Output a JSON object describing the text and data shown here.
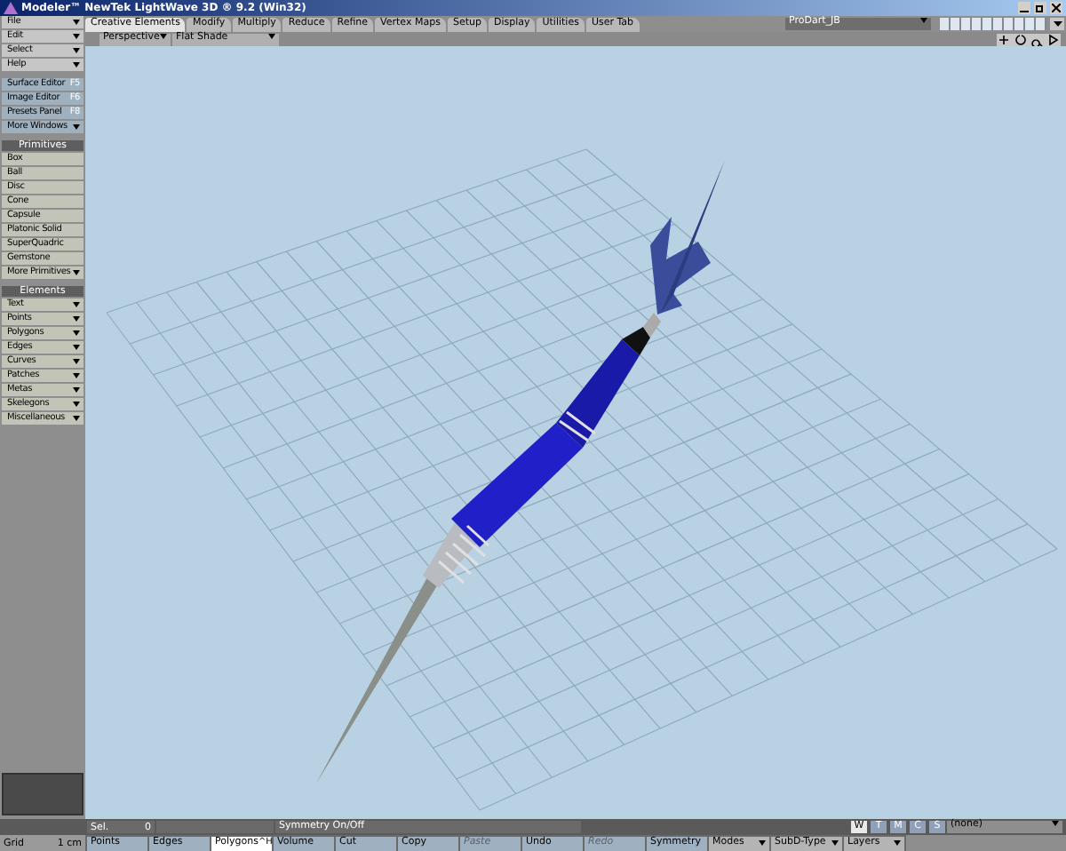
{
  "window": {
    "title": "Modeler™ NewTek LightWave 3D ® 9.2 (Win32)"
  },
  "menu": [
    {
      "label": "File",
      "kind": "dropdown"
    },
    {
      "label": "Edit",
      "kind": "dropdown"
    },
    {
      "label": "Select",
      "kind": "dropdown"
    },
    {
      "label": "Help",
      "kind": "dropdown"
    }
  ],
  "windows": [
    {
      "label": "Surface Editor",
      "shortcut": "F5",
      "kind": "button"
    },
    {
      "label": "Image Editor",
      "shortcut": "F6",
      "kind": "button"
    },
    {
      "label": "Presets Panel",
      "shortcut": "F8",
      "kind": "button"
    },
    {
      "label": "More Windows",
      "kind": "dropdown"
    }
  ],
  "primitives": {
    "title": "Primitives",
    "items": [
      {
        "label": "Box",
        "kind": "button"
      },
      {
        "label": "Ball",
        "kind": "button"
      },
      {
        "label": "Disc",
        "kind": "button"
      },
      {
        "label": "Cone",
        "kind": "button"
      },
      {
        "label": "Capsule",
        "kind": "button"
      },
      {
        "label": "Platonic Solid",
        "kind": "button"
      },
      {
        "label": "SuperQuadric",
        "kind": "button"
      },
      {
        "label": "Gemstone",
        "kind": "button"
      },
      {
        "label": "More Primitives",
        "kind": "dropdown"
      }
    ]
  },
  "elements": {
    "title": "Elements",
    "items": [
      {
        "label": "Text",
        "kind": "dropdown"
      },
      {
        "label": "Points",
        "kind": "dropdown"
      },
      {
        "label": "Polygons",
        "kind": "dropdown"
      },
      {
        "label": "Edges",
        "kind": "dropdown"
      },
      {
        "label": "Curves",
        "kind": "dropdown"
      },
      {
        "label": "Patches",
        "kind": "dropdown"
      },
      {
        "label": "Metas",
        "kind": "dropdown"
      },
      {
        "label": "Skelegons",
        "kind": "dropdown"
      },
      {
        "label": "Miscellaneous",
        "kind": "dropdown"
      }
    ]
  },
  "tabs": [
    {
      "label": "Creative Elements",
      "selected": true
    },
    {
      "label": "Modify",
      "selected": false
    },
    {
      "label": "Multiply",
      "selected": false
    },
    {
      "label": "Reduce",
      "selected": false
    },
    {
      "label": "Refine",
      "selected": false
    },
    {
      "label": "Vertex Maps",
      "selected": false
    },
    {
      "label": "Setup",
      "selected": false
    },
    {
      "label": "Display",
      "selected": false
    },
    {
      "label": "Utilities",
      "selected": false
    },
    {
      "label": "User Tab",
      "selected": false
    }
  ],
  "object_dropdown": {
    "value": "ProDart_JB"
  },
  "viewport": {
    "view": "Perspective",
    "shading": "Flat Shade"
  },
  "grid": {
    "label": "Grid",
    "value": "1 cm"
  },
  "status": {
    "sel_label": "Sel.",
    "sel_value": "0",
    "symmetry_label": "Symmetry On/Off",
    "map_buttons": [
      {
        "label": "W",
        "selected": true
      },
      {
        "label": "T",
        "selected": false
      },
      {
        "label": "M",
        "selected": false
      },
      {
        "label": "C",
        "selected": false
      },
      {
        "label": "S",
        "selected": false
      }
    ],
    "map_value": "(none)"
  },
  "bottom_buttons": [
    {
      "label": "Points",
      "kind": "button",
      "selected": false,
      "disabled": false
    },
    {
      "label": "Edges",
      "kind": "button",
      "selected": false,
      "disabled": false
    },
    {
      "label": "Polygons",
      "shortcut": "^H",
      "kind": "button",
      "selected": true,
      "disabled": false
    },
    {
      "label": "Volume",
      "kind": "button",
      "selected": false,
      "disabled": false
    },
    {
      "label": "Cut",
      "kind": "button",
      "selected": false,
      "disabled": false
    },
    {
      "label": "Copy",
      "kind": "button",
      "selected": false,
      "disabled": false
    },
    {
      "label": "Paste",
      "kind": "button",
      "selected": false,
      "disabled": true
    },
    {
      "label": "Undo",
      "kind": "button",
      "selected": false,
      "disabled": false
    },
    {
      "label": "Redo",
      "kind": "button",
      "selected": false,
      "disabled": true
    },
    {
      "label": "Symmetry",
      "kind": "button",
      "selected": false,
      "disabled": false
    },
    {
      "label": "Modes",
      "kind": "dropdown",
      "selected": false,
      "disabled": false
    },
    {
      "label": "SubD-Type",
      "kind": "dropdown",
      "selected": false,
      "disabled": false
    },
    {
      "label": "Layers",
      "kind": "dropdown",
      "selected": false,
      "disabled": false
    }
  ]
}
